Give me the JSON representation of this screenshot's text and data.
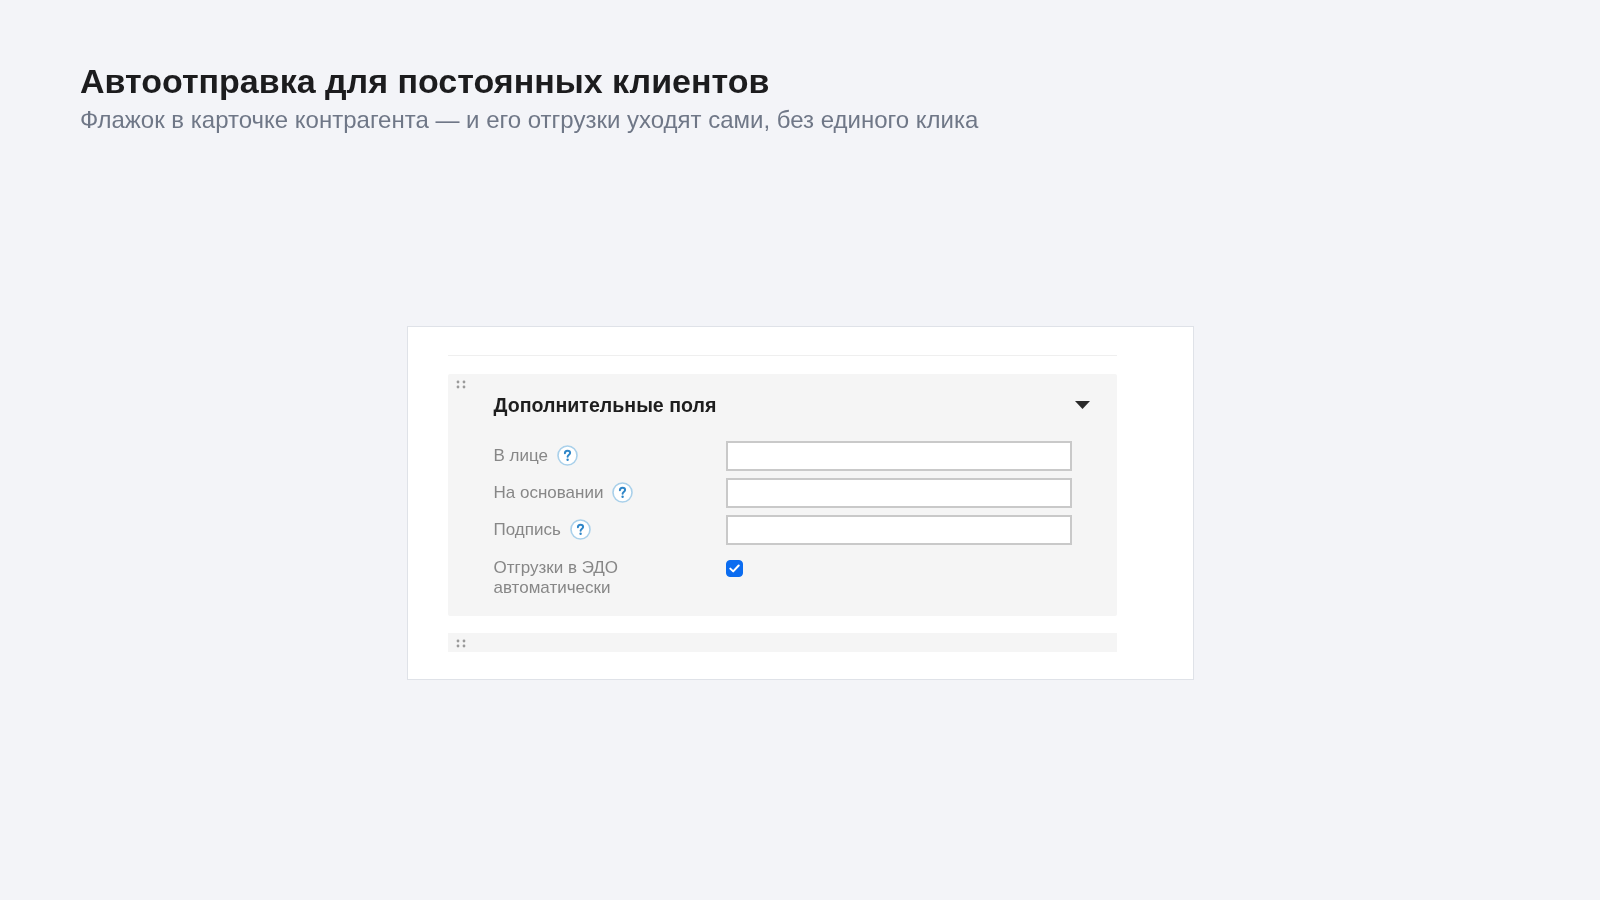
{
  "header": {
    "title": "Автоотправка для постоянных клиентов",
    "subtitle": "Флажок в карточке контрагента — и его отгрузки уходят сами, без единого клика"
  },
  "panel": {
    "title": "Дополнительные поля",
    "expanded": true,
    "fields": [
      {
        "kind": "text",
        "label": "В лице",
        "help": true
      },
      {
        "kind": "text",
        "label": "На основании",
        "help": true
      },
      {
        "kind": "text",
        "label": "Подпись",
        "help": true
      },
      {
        "kind": "checkbox",
        "label": "Отгрузки в ЭДО автоматически",
        "help": false,
        "checked": true
      }
    ]
  }
}
